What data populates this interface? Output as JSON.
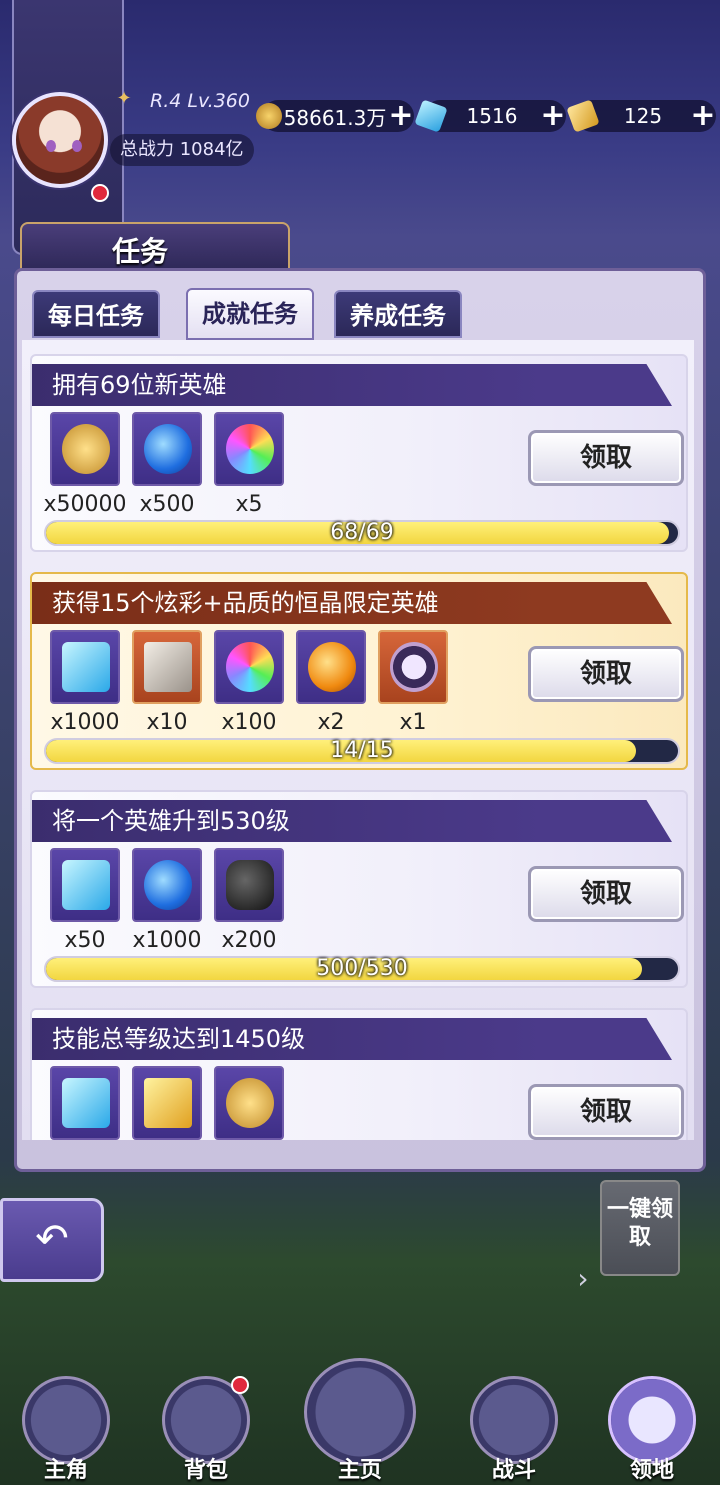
{
  "header": {
    "rank_level": "R.4 Lv.360",
    "power_label": "总战力",
    "power_value": "1084亿",
    "gold": "58661.3万",
    "crystal": "1516",
    "gem": "125"
  },
  "panel": {
    "title": "任务"
  },
  "tabs": [
    {
      "label": "每日任务",
      "active": false
    },
    {
      "label": "成就任务",
      "active": true
    },
    {
      "label": "养成任务",
      "active": false
    }
  ],
  "tasks": [
    {
      "title": "拥有69位新英雄",
      "rewards": [
        {
          "icon": "gold-coin-icon",
          "count": "x50000"
        },
        {
          "icon": "blue-potion-icon",
          "count": "x500"
        },
        {
          "icon": "rainbow-orb-icon",
          "count": "x5"
        }
      ],
      "progress_text": "68/69",
      "progress": 0.9855,
      "claim_label": "领取"
    },
    {
      "title": "获得15个炫彩+品质的恒晶限定英雄",
      "rewards": [
        {
          "icon": "blue-crystal-icon",
          "count": "x1000"
        },
        {
          "icon": "card-deck-icon",
          "count": "x10"
        },
        {
          "icon": "rainbow-orb-icon",
          "count": "x100"
        },
        {
          "icon": "orange-potion-icon",
          "count": "x2"
        },
        {
          "icon": "portal-frame-icon",
          "count": "x1"
        }
      ],
      "progress_text": "14/15",
      "progress": 0.9333,
      "claim_label": "领取"
    },
    {
      "title": "将一个英雄升到530级",
      "rewards": [
        {
          "icon": "blue-crystal-icon",
          "count": "x50"
        },
        {
          "icon": "blue-potion-icon",
          "count": "x1000"
        },
        {
          "icon": "dark-stone-icon",
          "count": "x200"
        }
      ],
      "progress_text": "500/530",
      "progress": 0.9434,
      "claim_label": "领取"
    },
    {
      "title": "技能总等级达到1450级",
      "rewards": [
        {
          "icon": "blue-crystal-icon",
          "count": ""
        },
        {
          "icon": "scroll-icon",
          "count": ""
        },
        {
          "icon": "gold-coin-icon",
          "count": ""
        }
      ],
      "claim_label": "领取"
    }
  ],
  "onekey_label": "一键领取",
  "nav": [
    {
      "label": "主角",
      "active": false
    },
    {
      "label": "背包",
      "active": false,
      "badge": true
    },
    {
      "label": "主页",
      "active": false
    },
    {
      "label": "战斗",
      "active": false
    },
    {
      "label": "领地",
      "active": true
    }
  ],
  "colors": {
    "progress_fill": "#f2d640",
    "badge_red": "#e0283c",
    "header_purple": "#3b2d6e",
    "header_gold_task": "#7a2e18"
  }
}
